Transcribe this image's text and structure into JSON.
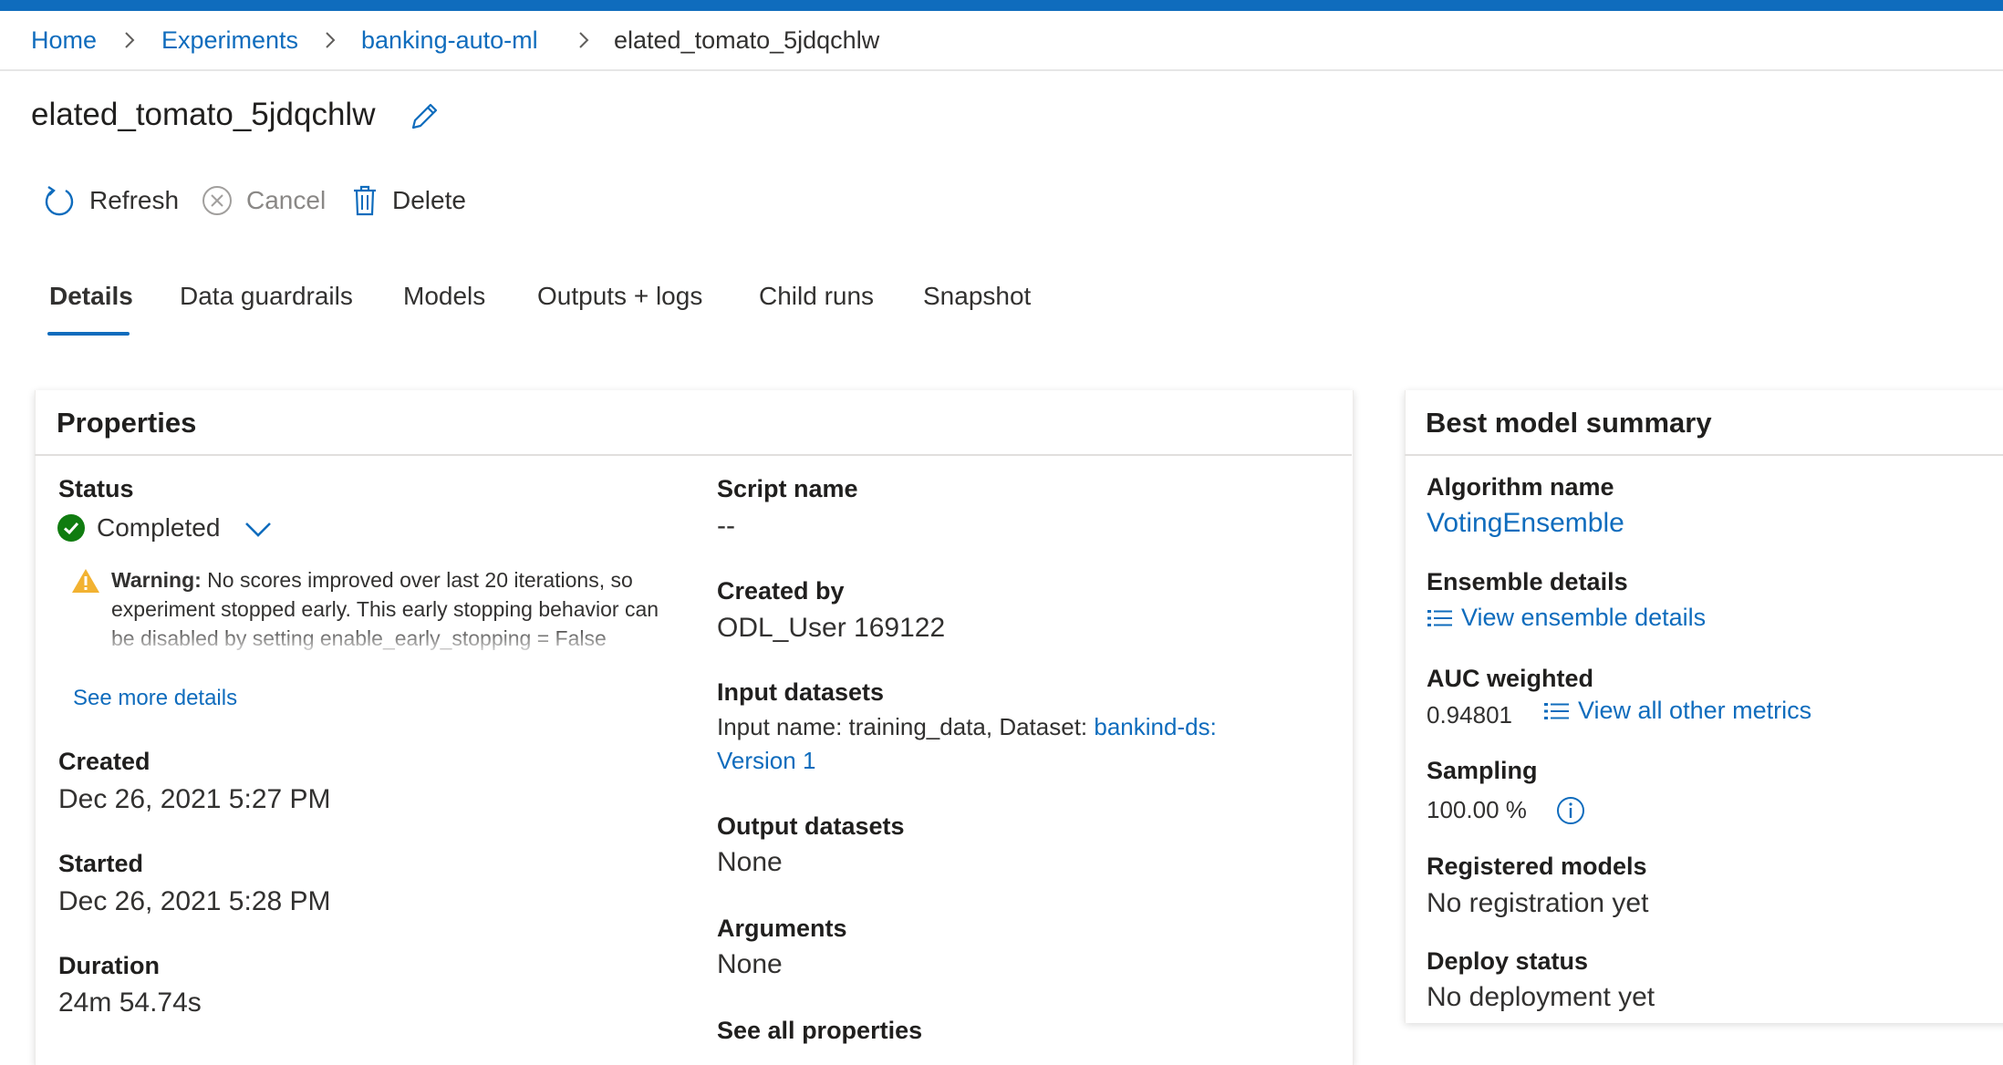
{
  "breadcrumb": {
    "items": [
      "Home",
      "Experiments",
      "banking-auto-ml"
    ],
    "current": "elated_tomato_5jdqchlw"
  },
  "page": {
    "title": "elated_tomato_5jdqchlw"
  },
  "commands": {
    "refresh": "Refresh",
    "cancel": "Cancel",
    "delete": "Delete"
  },
  "tabs": [
    "Details",
    "Data guardrails",
    "Models",
    "Outputs + logs",
    "Child runs",
    "Snapshot"
  ],
  "active_tab": "Details",
  "properties": {
    "title": "Properties",
    "status_label": "Status",
    "status_value": "Completed",
    "warning_prefix": "Warning:",
    "warning_text": " No scores improved over last 20 iterations, so experiment stopped early. This early stopping behavior can be disabled by setting enable_early_stopping = False",
    "see_more": "See more details",
    "created_label": "Created",
    "created_value": "Dec 26, 2021 5:27 PM",
    "started_label": "Started",
    "started_value": "Dec 26, 2021 5:28 PM",
    "duration_label": "Duration",
    "duration_value": "24m 54.74s",
    "script_label": "Script name",
    "script_value": "--",
    "created_by_label": "Created by",
    "created_by_value": "ODL_User 169122",
    "input_label": "Input datasets",
    "input_prefix": "Input name: training_data, Dataset: ",
    "input_link_1": "bankind-ds:",
    "input_link_2": "Version 1",
    "output_label": "Output datasets",
    "output_value": "None",
    "arguments_label": "Arguments",
    "arguments_value": "None",
    "see_all": "See all properties"
  },
  "best_model": {
    "title": "Best model summary",
    "algorithm_label": "Algorithm name",
    "algorithm_value": "VotingEnsemble",
    "ensemble_label": "Ensemble details",
    "ensemble_link": "View ensemble details",
    "auc_label": "AUC weighted",
    "auc_value": "0.94801",
    "metrics_link": "View all other metrics",
    "sampling_label": "Sampling",
    "sampling_value": "100.00 %",
    "registered_label": "Registered models",
    "registered_value": "No registration yet",
    "deploy_label": "Deploy status",
    "deploy_value": "No deployment yet"
  },
  "colors": {
    "accent": "#0f6cbd",
    "success": "#107c10",
    "warning": "#f2b231"
  }
}
